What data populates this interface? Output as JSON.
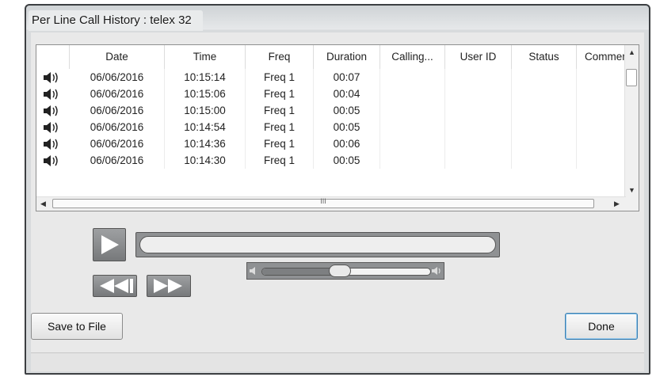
{
  "window": {
    "title": "Per Line Call History : telex 32"
  },
  "grid": {
    "columns": [
      "Date",
      "Time",
      "Freq",
      "Duration",
      "Calling...",
      "User ID",
      "Status",
      "Comment"
    ],
    "rows": [
      {
        "date": "06/06/2016",
        "time": "10:15:14",
        "freq": "Freq 1",
        "duration": "00:07"
      },
      {
        "date": "06/06/2016",
        "time": "10:15:06",
        "freq": "Freq 1",
        "duration": "00:04"
      },
      {
        "date": "06/06/2016",
        "time": "10:15:00",
        "freq": "Freq 1",
        "duration": "00:05"
      },
      {
        "date": "06/06/2016",
        "time": "10:14:54",
        "freq": "Freq 1",
        "duration": "00:05"
      },
      {
        "date": "06/06/2016",
        "time": "10:14:36",
        "freq": "Freq 1",
        "duration": "00:06"
      },
      {
        "date": "06/06/2016",
        "time": "10:14:30",
        "freq": "Freq 1",
        "duration": "00:05"
      }
    ],
    "hscroll_marker": "III"
  },
  "player": {
    "volume_level": 0.46
  },
  "buttons": {
    "save": "Save to File",
    "done": "Done"
  },
  "icons": {
    "row": "speaker-icon",
    "play": "play-icon",
    "rewind": "rewind-icon",
    "forward": "fast-forward-icon"
  }
}
